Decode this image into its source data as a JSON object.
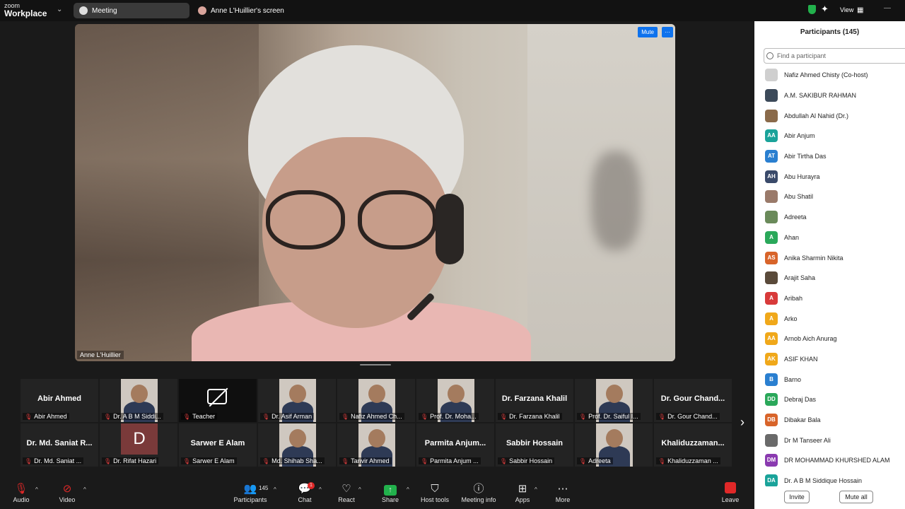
{
  "app": {
    "logo_line1": "zoom",
    "logo_line2": "Workplace"
  },
  "tabs": {
    "meeting": "Meeting",
    "screen": "Anne L'Huillier's screen"
  },
  "topright": {
    "view": "View"
  },
  "main_video": {
    "speaker": "Anne L'Huillier",
    "mute_label": "Mute",
    "more_label": "···"
  },
  "gallery": {
    "row1": [
      {
        "name": "Abir Ahmed",
        "label": "Abir Ahmed",
        "type": "name"
      },
      {
        "name": "",
        "label": "Dr. A B M Siddi...",
        "type": "video"
      },
      {
        "name": "",
        "label": "Teacher",
        "type": "nocam"
      },
      {
        "name": "",
        "label": "Dr. Asif Arman",
        "type": "video"
      },
      {
        "name": "",
        "label": "Nafiz Ahmed Ch...",
        "type": "video"
      },
      {
        "name": "",
        "label": "Prof. Dr. Moha...",
        "type": "video"
      },
      {
        "name": "Dr. Farzana Khalil",
        "label": "Dr. Farzana Khalil",
        "type": "name"
      },
      {
        "name": "",
        "label": "Prof. Dr. Saiful I...",
        "type": "video"
      },
      {
        "name": "Dr. Gour Chand...",
        "label": "Dr. Gour Chand...",
        "type": "name"
      }
    ],
    "row2": [
      {
        "name": "Dr. Md. Saniat R...",
        "label": "Dr. Md. Saniat ...",
        "type": "name"
      },
      {
        "name": "D",
        "label": "Dr. Rifat Hazari",
        "type": "initial"
      },
      {
        "name": "Sarwer E Alam",
        "label": "Sarwer E Alam",
        "type": "name"
      },
      {
        "name": "",
        "label": "Md. Shihab Sha...",
        "type": "video"
      },
      {
        "name": "",
        "label": "Tanvir Ahmed",
        "type": "video"
      },
      {
        "name": "Parmita Anjum...",
        "label": "Parmita Anjum ...",
        "type": "name"
      },
      {
        "name": "Sabbir Hossain",
        "label": "Sabbir Hossain",
        "type": "name"
      },
      {
        "name": "",
        "label": "Adreeta",
        "type": "video"
      },
      {
        "name": "Khaliduzzaman...",
        "label": "Khaliduzzaman ...",
        "type": "name"
      }
    ]
  },
  "toolbar": {
    "audio": "Audio",
    "video": "Video",
    "participants": "Participants",
    "participants_count": "145",
    "chat": "Chat",
    "chat_badge": "1",
    "react": "React",
    "share": "Share",
    "host_tools": "Host tools",
    "meeting_info": "Meeting info",
    "apps": "Apps",
    "more": "More",
    "leave": "Leave"
  },
  "participants_panel": {
    "title": "Participants (145)",
    "search_placeholder": "Find a participant",
    "invite": "Invite",
    "mute_all": "Mute all",
    "list": [
      {
        "name": "Nafiz Ahmed Chisty (Co-host)",
        "initials": "",
        "color": "#cfcfcf"
      },
      {
        "name": "A.M. SAKIBUR RAHMAN",
        "initials": "",
        "color": "#3c4a5a"
      },
      {
        "name": "Abdullah Al Nahid (Dr.)",
        "initials": "",
        "color": "#8a6a4a"
      },
      {
        "name": "Abir Anjum",
        "initials": "AA",
        "color": "#1aa39a"
      },
      {
        "name": "Abir Tirtha Das",
        "initials": "AT",
        "color": "#2a7fd0"
      },
      {
        "name": "Abu Hurayra",
        "initials": "AH",
        "color": "#3a4a6a"
      },
      {
        "name": "Abu Shatil",
        "initials": "",
        "color": "#9a7a6a"
      },
      {
        "name": "Adreeta",
        "initials": "",
        "color": "#6a8a5a"
      },
      {
        "name": "Ahan",
        "initials": "A",
        "color": "#2aa85a"
      },
      {
        "name": "Anika Sharmin Nikita",
        "initials": "AS",
        "color": "#d8642a"
      },
      {
        "name": "Arajit Saha",
        "initials": "",
        "color": "#5a4a3a"
      },
      {
        "name": "Aribah",
        "initials": "A",
        "color": "#d83a3a"
      },
      {
        "name": "Arko",
        "initials": "A",
        "color": "#f0a81a"
      },
      {
        "name": "Arnob Aich Anurag",
        "initials": "AA",
        "color": "#f0a81a"
      },
      {
        "name": "ASIF KHAN",
        "initials": "AK",
        "color": "#f0a81a"
      },
      {
        "name": "Barno",
        "initials": "B",
        "color": "#2a7fd0"
      },
      {
        "name": "Debraj Das",
        "initials": "DD",
        "color": "#2aa85a"
      },
      {
        "name": "Dibakar Bala",
        "initials": "DB",
        "color": "#d8642a"
      },
      {
        "name": "Dr M Tanseer Ali",
        "initials": "",
        "color": "#6a6a6a"
      },
      {
        "name": "DR MOHAMMAD KHURSHED ALAM",
        "initials": "DM",
        "color": "#8a3ab0"
      },
      {
        "name": "Dr. A B M Siddique Hossain",
        "initials": "DA",
        "color": "#1aa39a"
      }
    ]
  }
}
